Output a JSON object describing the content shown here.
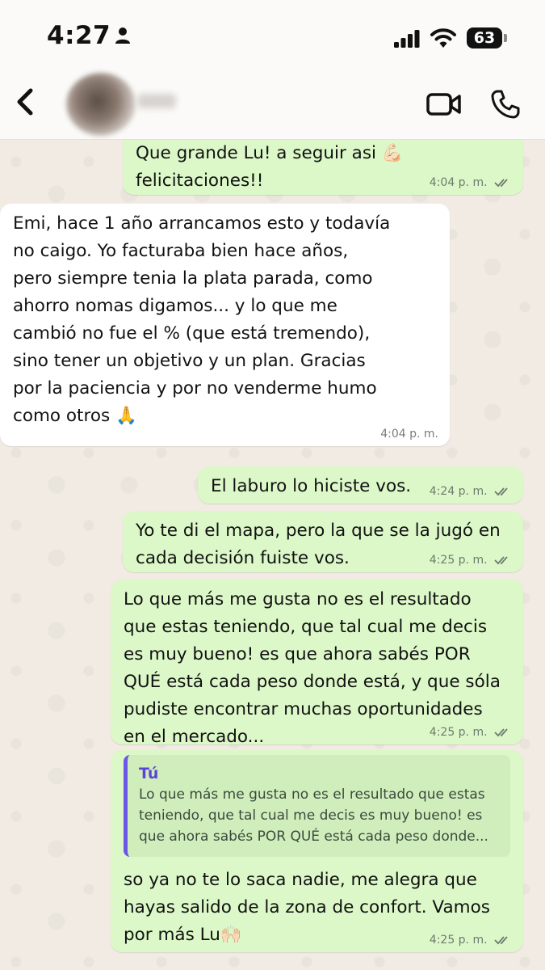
{
  "status_bar": {
    "time": "4:27",
    "battery_level": "63"
  },
  "header": {
    "contact_name": "Lu",
    "back_icon": "chevron-left-icon",
    "video_icon": "video-camera-icon",
    "call_icon": "phone-icon"
  },
  "messages": [
    {
      "direction": "out",
      "text": "Que grande Lu! a seguir asi 💪🏻\nfelicitaciones!!",
      "time": "4:04 p. m.",
      "read": true
    },
    {
      "direction": "in",
      "text": "Emi, hace 1 año arrancamos esto y todavía\nno caigo. Yo facturaba bien hace años,\npero siempre tenia la plata parada, como\nahorro nomas digamos... y lo que me\ncambió no fue el % (que está tremendo),\nsino tener un objetivo y un plan. Gracias\npor la paciencia y por no venderme humo\ncomo otros 🙏",
      "time": "4:04 p. m."
    },
    {
      "direction": "out",
      "text": "El laburo lo hiciste vos.",
      "time": "4:24 p. m.",
      "read": true
    },
    {
      "direction": "out",
      "text": "Yo te di el mapa, pero la que se la jugó en\ncada decisión fuiste vos.",
      "time": "4:25 p. m.",
      "read": true
    },
    {
      "direction": "out",
      "text": "Lo que más me gusta no es el resultado\nque estas teniendo, que tal cual me decis\nes muy bueno! es que ahora sabés POR\nQUÉ está cada peso donde está, y que sóla\npudiste encontrar muchas oportunidades\nen el mercado...",
      "time": "4:25 p. m.",
      "read": true
    },
    {
      "direction": "out",
      "quote_author": "Tú",
      "quote_text": "Lo que más me gusta no es el resultado que estas\nteniendo, que tal cual me decis es muy bueno! es\nque ahora sabés POR QUÉ está cada peso donde...",
      "text": "so ya no te lo saca nadie, me alegra que\nhayas salido de la zona de confort. Vamos\npor más Lu🙌🏻",
      "time": "4:25 p. m.",
      "read": true
    }
  ],
  "colors": {
    "outgoing_bubble": "#dcf8c8",
    "incoming_bubble": "#ffffff",
    "quote_bar": "#6b57e6",
    "read_ticks": "#6f7a70"
  }
}
